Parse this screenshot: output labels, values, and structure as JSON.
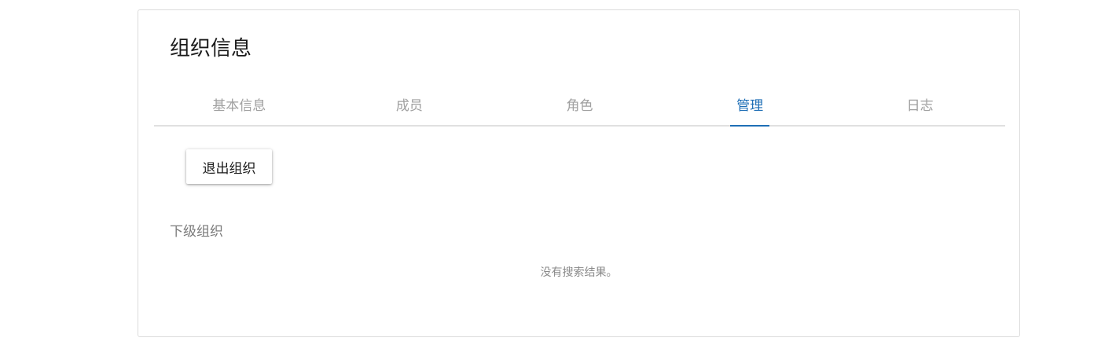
{
  "page": {
    "title": "组织信息"
  },
  "tabs": [
    {
      "label": "基本信息",
      "active": false
    },
    {
      "label": "成员",
      "active": false
    },
    {
      "label": "角色",
      "active": false
    },
    {
      "label": "管理",
      "active": true
    },
    {
      "label": "日志",
      "active": false
    }
  ],
  "actions": {
    "leave_label": "退出组织"
  },
  "sub_orgs": {
    "heading": "下级组织",
    "empty_message": "没有搜索结果。"
  },
  "colors": {
    "accent": "#1f6fb6",
    "tab_inactive": "#a0a0a0",
    "border": "#dcdcdc"
  }
}
